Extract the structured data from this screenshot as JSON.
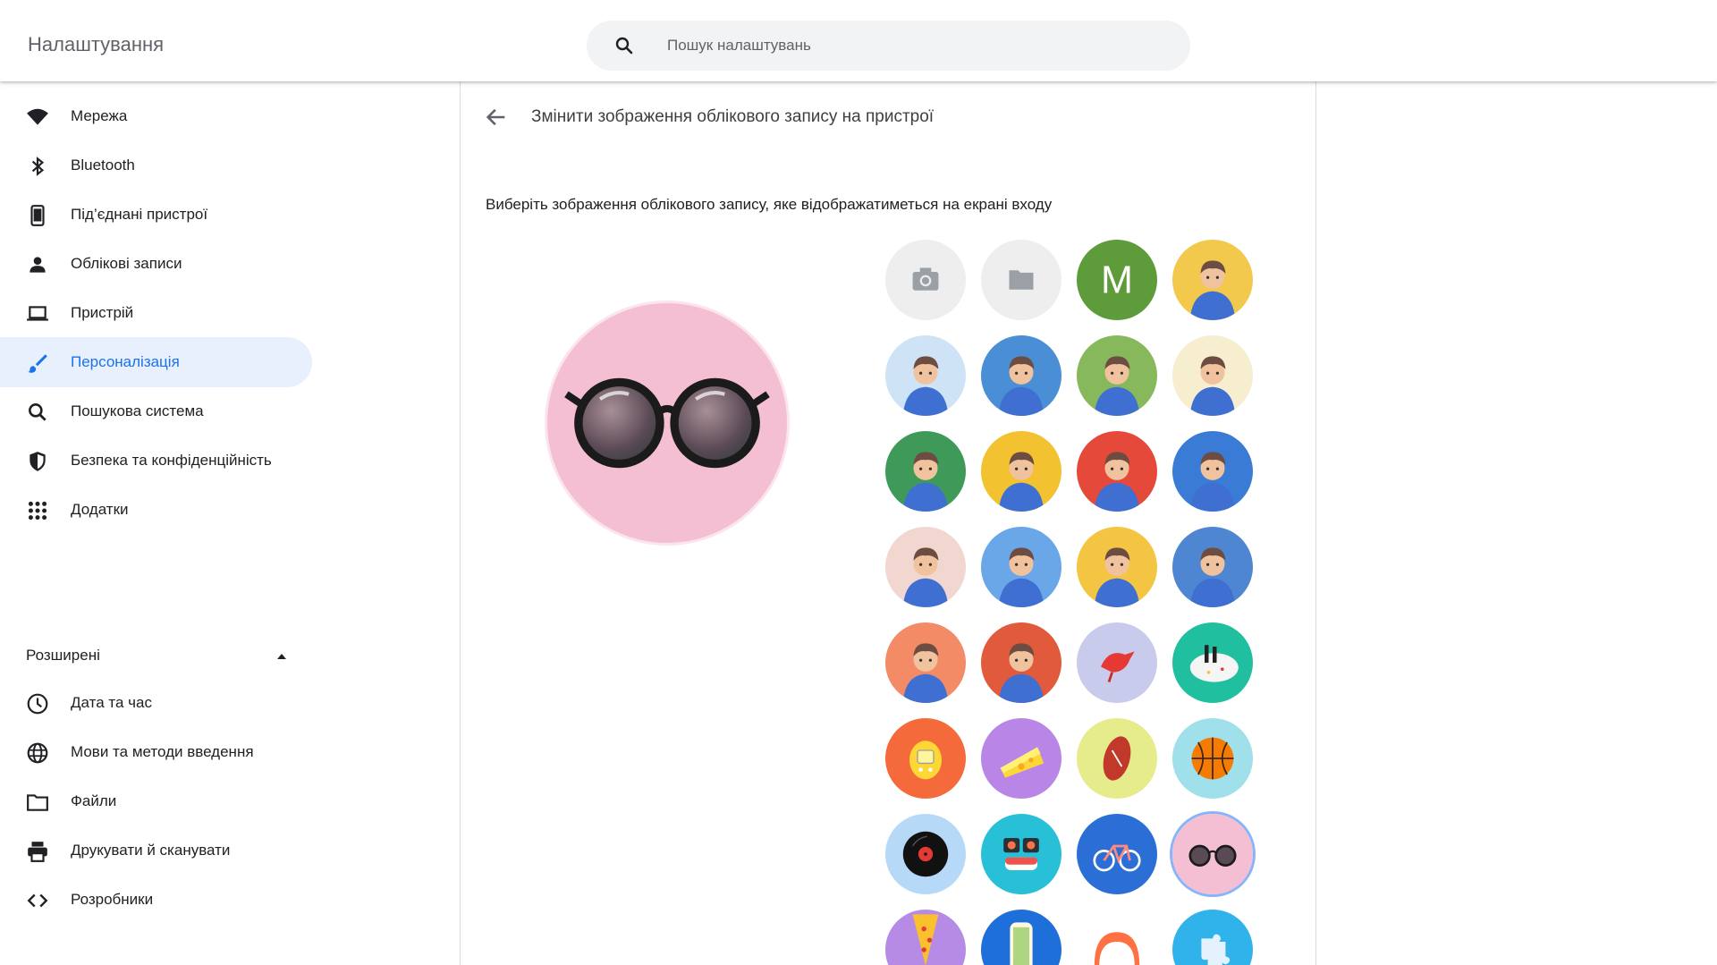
{
  "header": {
    "title": "Налаштування",
    "search_placeholder": "Пошук налаштувань"
  },
  "sidebar": {
    "items": [
      {
        "label": "Мережа",
        "icon": "wifi-icon"
      },
      {
        "label": "Bluetooth",
        "icon": "bluetooth-icon"
      },
      {
        "label": "Під’єднані пристрої",
        "icon": "phone-icon"
      },
      {
        "label": "Облікові записи",
        "icon": "person-icon"
      },
      {
        "label": "Пристрій",
        "icon": "laptop-icon"
      },
      {
        "label": "Персоналізація",
        "icon": "brush-icon",
        "active": true
      },
      {
        "label": "Пошукова система",
        "icon": "search-icon"
      },
      {
        "label": "Безпека та конфіденційність",
        "icon": "shield-icon"
      },
      {
        "label": "Додатки",
        "icon": "apps-grid-icon"
      }
    ],
    "advanced_label": "Розширені",
    "advanced_items": [
      {
        "label": "Дата та час",
        "icon": "clock-icon"
      },
      {
        "label": "Мови та методи введення",
        "icon": "globe-icon"
      },
      {
        "label": "Файли",
        "icon": "folder-icon"
      },
      {
        "label": "Друкувати й сканувати",
        "icon": "printer-icon"
      },
      {
        "label": "Розробники",
        "icon": "code-icon"
      }
    ]
  },
  "main": {
    "title": "Змінити зображення облікового запису на пристрої",
    "description": "Виберіть зображення облікового запису, яке відображатиметься на екрані входу",
    "preview_image": "sunglasses",
    "avatars": [
      {
        "name": "camera-option",
        "type": "camera-icon"
      },
      {
        "name": "file-option",
        "type": "folder-icon"
      },
      {
        "name": "initial-avatar",
        "letter": "M",
        "color": "#5e9b3a"
      },
      {
        "name": "illustration-1",
        "bg": "#f2c94c"
      },
      {
        "name": "illustration-2",
        "bg": "#cfe3f7"
      },
      {
        "name": "illustration-3",
        "bg": "#4a8ed6"
      },
      {
        "name": "illustration-4",
        "bg": "#87b85c"
      },
      {
        "name": "illustration-5",
        "bg": "#f7edcf"
      },
      {
        "name": "illustration-6",
        "bg": "#3f9a5a"
      },
      {
        "name": "illustration-7",
        "bg": "#f2c230"
      },
      {
        "name": "illustration-8",
        "bg": "#e5493a"
      },
      {
        "name": "illustration-9",
        "bg": "#3a7bd5"
      },
      {
        "name": "illustration-10",
        "bg": "#f2d6d0"
      },
      {
        "name": "illustration-11",
        "bg": "#6aa7e8"
      },
      {
        "name": "illustration-12",
        "bg": "#f4c542"
      },
      {
        "name": "illustration-13",
        "bg": "#4f86d1"
      },
      {
        "name": "illustration-14",
        "bg": "#f28b66"
      },
      {
        "name": "illustration-15",
        "bg": "#e25a3c"
      },
      {
        "name": "bird",
        "bg": "#c9cbec"
      },
      {
        "name": "cake",
        "bg": "#1fbf9f"
      },
      {
        "name": "tamagotchi",
        "bg": "#f56a3a"
      },
      {
        "name": "cheese",
        "bg": "#b986e8"
      },
      {
        "name": "football",
        "bg": "#e6ec8c"
      },
      {
        "name": "basketball",
        "bg": "#9fe0ea"
      },
      {
        "name": "vinyl",
        "bg": "#b5d9f7"
      },
      {
        "name": "sushi",
        "bg": "#27c0d6"
      },
      {
        "name": "bicycle",
        "bg": "#2b6fd6"
      },
      {
        "name": "sunglasses",
        "bg": "#f5bfd3",
        "selected": true
      },
      {
        "name": "pizza",
        "bg": "#b58be6"
      },
      {
        "name": "sandwich",
        "bg": "#1e6fd9"
      },
      {
        "name": "watermelon",
        "bg": "#ffffff"
      },
      {
        "name": "puzzle",
        "bg": "#2fb3ea"
      }
    ]
  }
}
